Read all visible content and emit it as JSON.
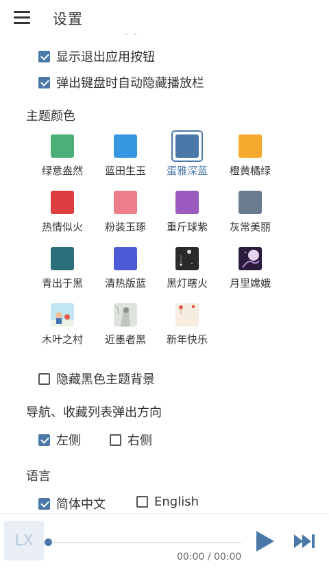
{
  "header": {
    "title": "设置",
    "menu_icon": "hamburger-menu-icon"
  },
  "options": {
    "show_exit_button": {
      "label": "显示退出应用按钮",
      "checked": true
    },
    "hide_player_bar_on_keyboard": {
      "label": "弹出键盘时自动隐藏播放栏",
      "checked": true
    }
  },
  "theme_section": {
    "title": "主题颜色",
    "themes": [
      {
        "label": "绿意盎然",
        "color": "#4baf77",
        "active": false
      },
      {
        "label": "蓝田生玉",
        "color": "#3598e0",
        "active": false
      },
      {
        "label": "蛋雅深蓝",
        "color": "#4a78a8",
        "active": true
      },
      {
        "label": "橙黄橘绿",
        "color": "#f5a92d",
        "active": false
      },
      {
        "label": "热情似火",
        "color": "#de3e42",
        "active": false
      },
      {
        "label": "粉装玉琢",
        "color": "#ef7e8c",
        "active": false
      },
      {
        "label": "重斤球紫",
        "color": "#9c5bbf",
        "active": false
      },
      {
        "label": "灰常美丽",
        "color": "#6b7a8c",
        "active": false
      },
      {
        "label": "青出于黑",
        "color": "#2c6f7a",
        "active": false
      },
      {
        "label": "清热版蓝",
        "color": "#4c5ad6",
        "active": false
      },
      {
        "label": "黑灯瞎火",
        "color": "#2a2a2a",
        "active": false
      },
      {
        "label": "月里嫦娥",
        "color": "#2b1b3c",
        "active": false
      },
      {
        "label": "木叶之村",
        "color": "#bfe6f2",
        "active": false
      },
      {
        "label": "近墨者黑",
        "color": "#dfe3de",
        "active": false
      },
      {
        "label": "新年快乐",
        "color": "#f6ece0",
        "active": false
      }
    ]
  },
  "hide_black_bg": {
    "label": "隐藏黑色主题背景",
    "checked": false
  },
  "nav_direction": {
    "title": "导航、收藏列表弹出方向",
    "left": {
      "label": "左侧",
      "checked": true
    },
    "right": {
      "label": "右侧",
      "checked": false
    }
  },
  "language": {
    "title": "语言",
    "zh": {
      "label": "简体中文",
      "checked": true
    },
    "en": {
      "label": "English",
      "checked": false
    }
  },
  "player": {
    "cover_text": "LX",
    "time": "00:00 / 00:00",
    "progress": 0,
    "accent": "#4a78a8"
  }
}
